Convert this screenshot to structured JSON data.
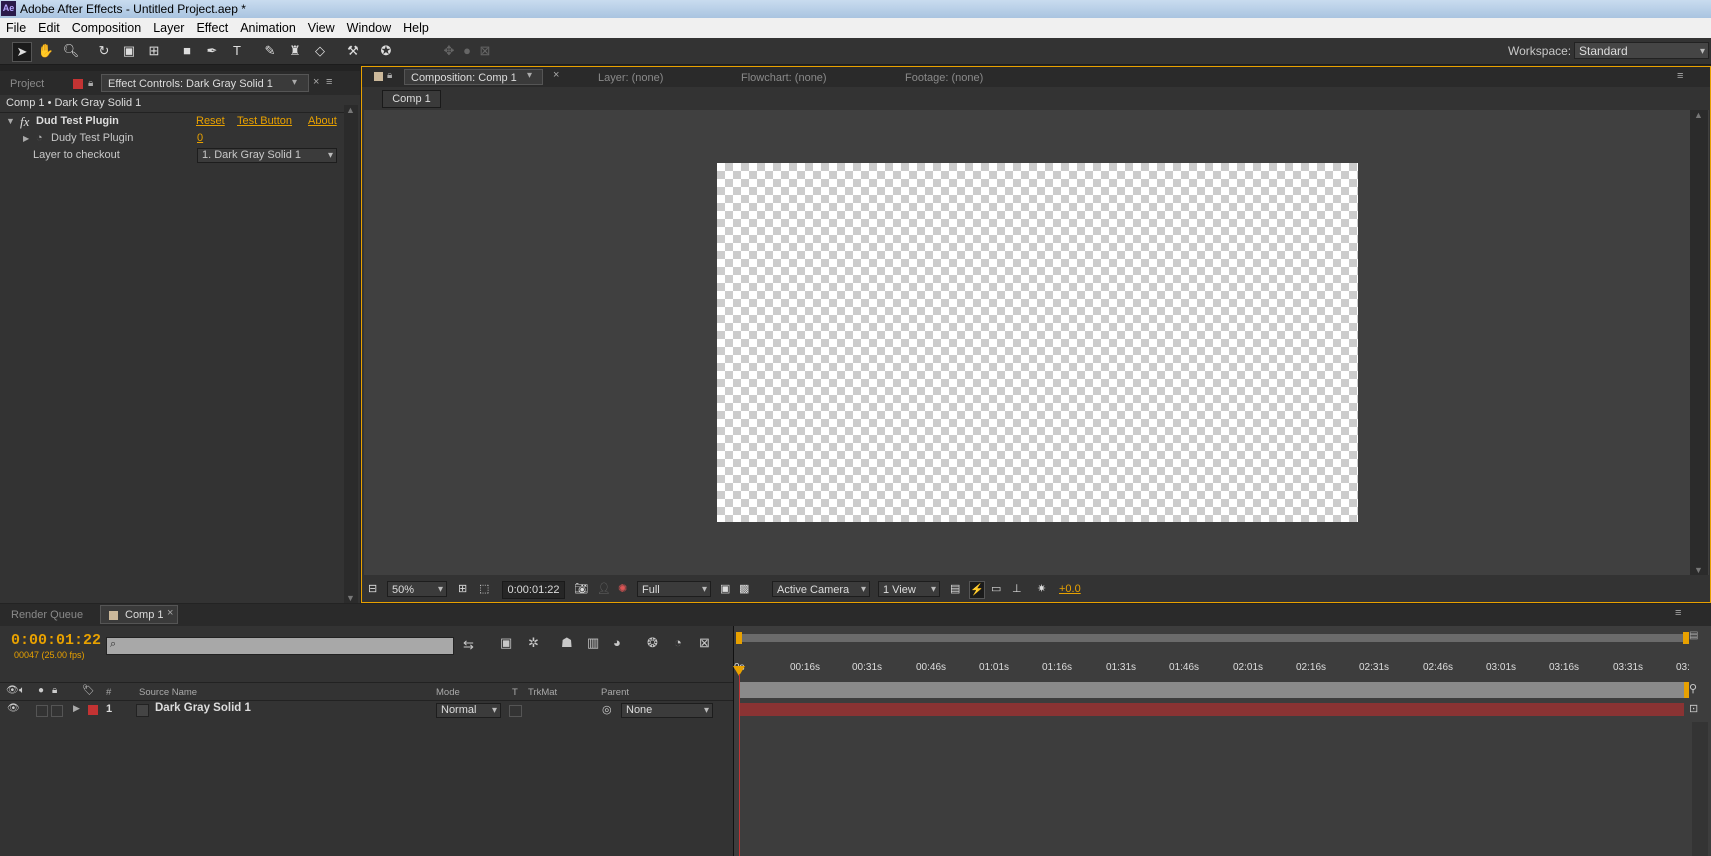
{
  "window": {
    "title": "Adobe After Effects - Untitled Project.aep *",
    "app_icon": "Ae"
  },
  "menu": [
    "File",
    "Edit",
    "Composition",
    "Layer",
    "Effect",
    "Animation",
    "View",
    "Window",
    "Help"
  ],
  "workspace": {
    "label": "Workspace:",
    "value": "Standard"
  },
  "left_panel": {
    "tab_project": "Project",
    "tab_effect_controls": "Effect Controls: Dark Gray Solid 1",
    "breadcrumb": "Comp 1 • Dark Gray Solid 1",
    "effect": {
      "fx": "fx",
      "name": "Dud Test Plugin",
      "reset": "Reset",
      "test_button": "Test Button",
      "about": "About",
      "param1_label": "Dudy Test Plugin",
      "param1_value": "0",
      "param2_label": "Layer to checkout",
      "param2_value": "1. Dark Gray Solid 1"
    }
  },
  "comp_panel": {
    "tab_comp": "Composition: Comp 1",
    "tab_layer": "Layer: (none)",
    "tab_flowchart": "Flowchart: (none)",
    "tab_footage": "Footage: (none)",
    "sub_tab": "Comp 1",
    "zoom": "50%",
    "timecode": "0:00:01:22",
    "resolution": "Full",
    "camera": "Active Camera",
    "views": "1 View",
    "exposure": "+0.0"
  },
  "timeline": {
    "tab_render": "Render Queue",
    "tab_comp": "Comp 1",
    "current_time": "0:00:01:22",
    "frame_info": "00047 (25.00 fps)",
    "search_icon": "⌕",
    "col_source": "Source Name",
    "col_mode": "Mode",
    "col_t": "T",
    "col_trkmat": "TrkMat",
    "col_parent": "Parent",
    "col_hash": "#",
    "layer": {
      "num": "1",
      "name": "Dark Gray Solid 1",
      "mode": "Normal",
      "parent": "None"
    },
    "ruler": [
      "0s",
      "00:16s",
      "00:31s",
      "00:46s",
      "01:01s",
      "01:16s",
      "01:31s",
      "01:46s",
      "02:01s",
      "02:16s",
      "02:31s",
      "02:46s",
      "03:01s",
      "03:16s",
      "03:31s",
      "03:"
    ],
    "colors": {
      "layer_bar": "#8a3333",
      "label_red": "#c33333",
      "accent": "#e8a100"
    }
  }
}
